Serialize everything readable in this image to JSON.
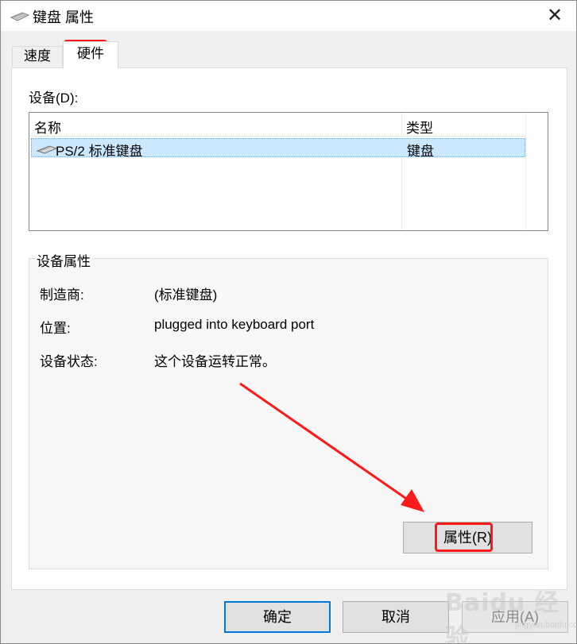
{
  "window": {
    "title": "键盘 属性",
    "close_glyph": "✕"
  },
  "tabs": [
    {
      "label": "速度",
      "active": false
    },
    {
      "label": "硬件",
      "active": true
    }
  ],
  "devices": {
    "label": "设备(D):",
    "columns": [
      "名称",
      "类型"
    ],
    "rows": [
      {
        "name": "PS/2 标准键盘",
        "type": "键盘",
        "icon": "keyboard-icon",
        "selected": true
      }
    ]
  },
  "device_properties": {
    "title": "设备属性",
    "items": [
      {
        "label": "制造商:",
        "value": "(标准键盘)"
      },
      {
        "label": "位置:",
        "value": "plugged into keyboard port"
      },
      {
        "label": "设备状态:",
        "value": "这个设备运转正常。"
      }
    ],
    "properties_button": "属性(R)"
  },
  "buttons": {
    "ok": "确定",
    "cancel": "取消",
    "apply": "应用(A)"
  },
  "annotations": {
    "highlight_color": "#ff1a1a"
  },
  "watermark": {
    "text": "Baidu 经验",
    "url": "jingyan.baidu.com"
  },
  "colors": {
    "selection": "#cce8ff",
    "default_button_border": "#0078d7"
  }
}
